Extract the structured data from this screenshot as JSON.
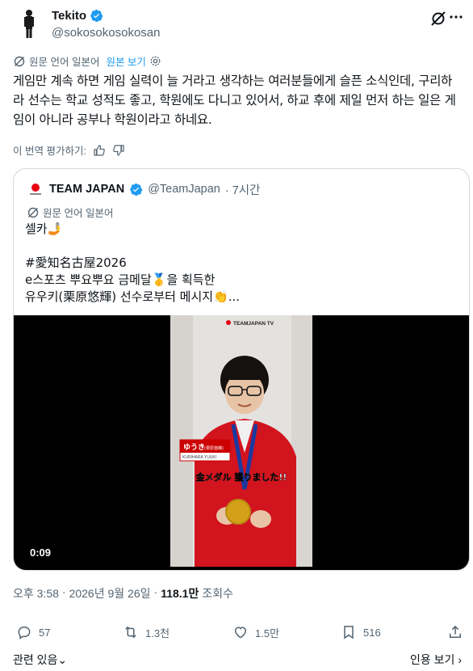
{
  "author": {
    "display_name": "Tekito",
    "handle": "@sokosokosokosan",
    "verified": true
  },
  "translation": {
    "source_label": "원문 언어 일본어",
    "show_original": "원본 보기"
  },
  "tweet_text": "게임만 계속 하면 게임 실력이 늘 거라고 생각하는 여러분들에게 슬픈 소식인데, 구리하라 선수는 학교 성적도 좋고, 학원에도 다니고 있어서, 하교 후에 제일 먼저 하는 일은 게임이 아니라 공부나 학원이라고 하네요.",
  "rate_translation": "이 번역 평가하기:",
  "quote": {
    "display_name": "TEAM JAPAN",
    "handle": "@TeamJapan",
    "time": "· 7시간",
    "translation_label": "원문 언어 일본어",
    "lines": [
      "셀카🤳",
      "",
      "#愛知名古屋2026",
      "e스포츠 뿌요뿌요 금메달🥇을 획득한",
      "유우키(栗原悠輝) 선수로부터 메시지👏..."
    ],
    "video": {
      "duration": "0:09",
      "watermark": "TEAMJAPAN TV",
      "name_tag": "ゆうき",
      "name_tag_sub": "(栗原悠輝)",
      "name_tag_roman": "KURIHARA YUUKI",
      "caption": "金メダル 獲りました!!"
    }
  },
  "meta": {
    "time": "오후 3:58",
    "date": "2026년 9월 26일",
    "views": "118.1만",
    "views_label": "조회수"
  },
  "actions": {
    "replies": "57",
    "reposts": "1.3천",
    "likes": "1.5만",
    "bookmarks": "516"
  },
  "footer": {
    "related": "관련 있음",
    "quotes": "인용 보기"
  },
  "colors": {
    "accent": "#1d9bf0",
    "secondary_text": "#536471",
    "border": "#cfd9de"
  }
}
